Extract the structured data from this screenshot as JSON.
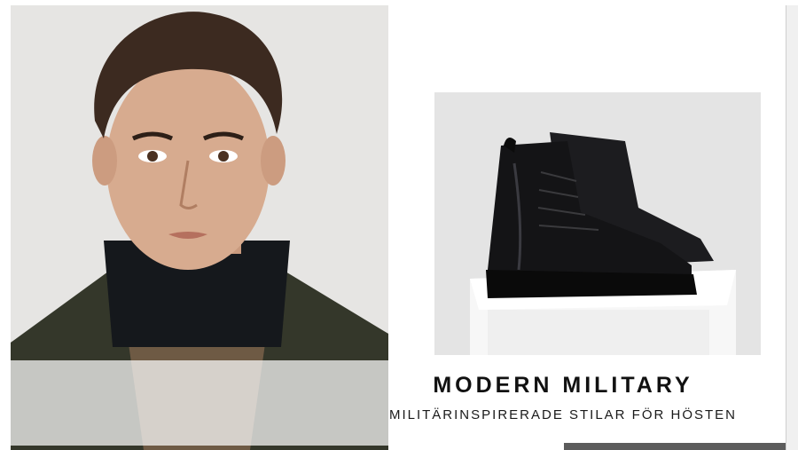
{
  "banner": {
    "title": "MODERN MILITARY",
    "subtitle": "MILITÄRINSPIRERADE STILAR FÖR HÖSTEN"
  },
  "images": {
    "model": "model-portrait",
    "product": "black-lace-up-boot"
  },
  "colors": {
    "panel_bg": "#e6e5e3",
    "text": "#111111",
    "overlay": "rgba(255,255,255,0.72)",
    "bar": "#5c5c5c"
  }
}
